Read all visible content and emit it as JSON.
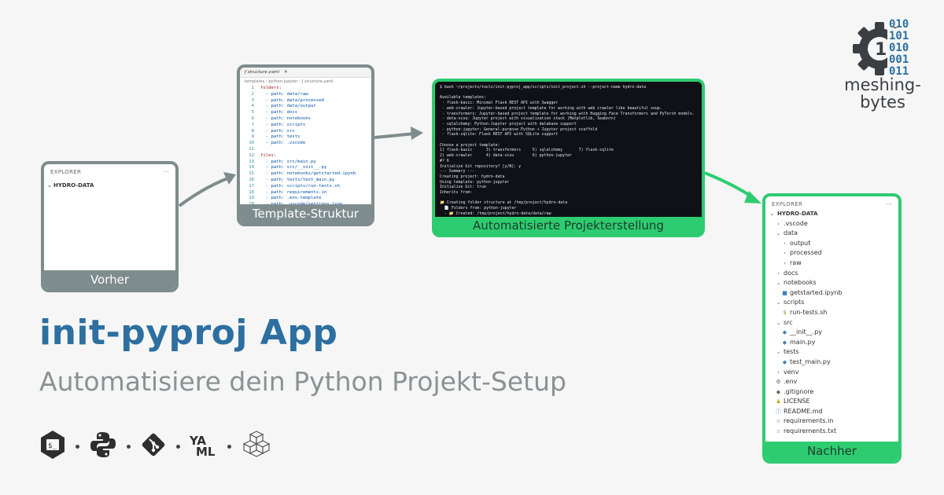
{
  "colors": {
    "gray": "#7f8c8d",
    "green": "#2ecc71",
    "title_blue": "#2c6fa0",
    "subtitle_gray": "#8a9394"
  },
  "vorher": {
    "explorer_label": "EXPLORER",
    "more": "···",
    "root": "HYDRO-DATA",
    "caption": "Vorher"
  },
  "template": {
    "tab_label": "structure.yaml",
    "breadcrumb": "templates › python-jupyter › ƒ structure.yaml",
    "caption": "Template-Struktur",
    "lines": [
      {
        "n": "1",
        "text": "folders:"
      },
      {
        "n": "2",
        "text": "  - path: data/raw"
      },
      {
        "n": "3",
        "text": "  - path: data/processed"
      },
      {
        "n": "4",
        "text": "  - path: data/output"
      },
      {
        "n": "5",
        "text": "  - path: docs"
      },
      {
        "n": "6",
        "text": "  - path: notebooks"
      },
      {
        "n": "7",
        "text": "  - path: scripts"
      },
      {
        "n": "8",
        "text": "  - path: src"
      },
      {
        "n": "9",
        "text": "  - path: tests"
      },
      {
        "n": "10",
        "text": "  - path: .vscode"
      },
      {
        "n": "11",
        "text": ""
      },
      {
        "n": "12",
        "text": "files:"
      },
      {
        "n": "13",
        "text": "  - path: src/main.py"
      },
      {
        "n": "14",
        "text": "  - path: src/__init__.py"
      },
      {
        "n": "15",
        "text": "  - path: notebooks/getstarted.ipynb"
      },
      {
        "n": "16",
        "text": "  - path: tests/test_main.py"
      },
      {
        "n": "17",
        "text": "  - path: scripts/run-tests.sh"
      },
      {
        "n": "18",
        "text": "  - path: requirements.in"
      },
      {
        "n": "19",
        "text": "  - path: .env.template"
      },
      {
        "n": "20",
        "text": "  - path: .vscode/settings.json"
      },
      {
        "n": "21",
        "text": ""
      }
    ]
  },
  "terminal": {
    "caption": "Automatisierte Projekterstellung",
    "text": "$ bash ~/projects/tools/init-pyproj_app/scripts/init_project.sh --project-name hydro-data\n\nAvailable templates:\n - flask-basic: Minimal Flask REST API with Swagger\n - web-crawler: Jupyter-based project template for working with web crawler like beautiful soup.\n - transformers: Jupyter-based project template for working with Hugging Face Transformers and PyTorch models.\n - data-visu: Jupyter project with visualization stack (Matplotlib, Seaborn)\n - sqlalchemy: Python-Jupyter project with database support\n - python-jupyter: General-purpose Python + Jupyter project scaffold\n - flask-sqlite: Flask REST API with SQLite support\n\nChoose a project template:\n1) flask-basic      3) transformers     5) sqlalchemy       7) flask-sqlite\n2) web-crawler      4) data-visu        6) python-jupyter\n#? 6\nInitialize Git repository? [y/N]: y\n--- Summary ---\nCreating project: hydro-data\nUsing template: python-jupyter\nInitialize Git: true\nInherits from:\n\n📁 Creating folder structure at /tmp/project/hydro-data\n  📄 Folders from: python-jupyter\n  - 📁 Created: /tmp/project/hydro-data/data/raw\n  - 📁 Created: /tmp/project/hydro-data/data/processed\n  - 📁 Created: /tmp/project/hydro-data/data/output"
  },
  "nachher": {
    "explorer_label": "EXPLORER",
    "more": "···",
    "caption": "Nachher",
    "tree": [
      {
        "icon": "chev-down",
        "glyph": "⌄",
        "label": "HYDRO-DATA",
        "indent": 0,
        "bold": true
      },
      {
        "icon": "chev-right",
        "glyph": "›",
        "label": ".vscode",
        "indent": 1
      },
      {
        "icon": "chev-down",
        "glyph": "⌄",
        "label": "data",
        "indent": 1
      },
      {
        "icon": "chev-right",
        "glyph": "›",
        "label": "output",
        "indent": 2
      },
      {
        "icon": "chev-right",
        "glyph": "›",
        "label": "processed",
        "indent": 2
      },
      {
        "icon": "chev-right",
        "glyph": "›",
        "label": "raw",
        "indent": 2
      },
      {
        "icon": "chev-right",
        "glyph": "›",
        "label": "docs",
        "indent": 1
      },
      {
        "icon": "chev-down",
        "glyph": "⌄",
        "label": "notebooks",
        "indent": 1
      },
      {
        "icon": "notebook",
        "glyph": "■",
        "label": "getstarted.ipynb",
        "indent": 2
      },
      {
        "icon": "chev-down",
        "glyph": "⌄",
        "label": "scripts",
        "indent": 1
      },
      {
        "icon": "shell",
        "glyph": "$",
        "label": "run-tests.sh",
        "indent": 2
      },
      {
        "icon": "chev-down",
        "glyph": "⌄",
        "label": "src",
        "indent": 1
      },
      {
        "icon": "python",
        "glyph": "◆",
        "label": "__init__.py",
        "indent": 2
      },
      {
        "icon": "python",
        "glyph": "◆",
        "label": "main.py",
        "indent": 2
      },
      {
        "icon": "chev-down",
        "glyph": "⌄",
        "label": "tests",
        "indent": 1
      },
      {
        "icon": "python",
        "glyph": "◆",
        "label": "test_main.py",
        "indent": 2
      },
      {
        "icon": "chev-right",
        "glyph": "›",
        "label": "venv",
        "indent": 1
      },
      {
        "icon": "gear",
        "glyph": "⚙",
        "label": ".env",
        "indent": 1
      },
      {
        "icon": "git",
        "glyph": "◆",
        "label": ".gitignore",
        "indent": 1
      },
      {
        "icon": "license",
        "glyph": "♟",
        "label": "LICENSE",
        "indent": 1
      },
      {
        "icon": "info",
        "glyph": "ⓘ",
        "label": "README.md",
        "indent": 1
      },
      {
        "icon": "text",
        "glyph": "≡",
        "label": "requirements.in",
        "indent": 1
      },
      {
        "icon": "text",
        "glyph": "≡",
        "label": "requirements.txt",
        "indent": 1
      }
    ]
  },
  "heading": {
    "title": "init-pyproj App",
    "subtitle": "Automatisiere dein Python Projekt-Setup"
  },
  "tech_icons": [
    "bash-icon",
    "python-icon",
    "git-icon",
    "yaml-icon",
    "boxes-icon"
  ],
  "yaml_icon_text": [
    "YA",
    "ML"
  ],
  "logo": {
    "binary": [
      "010",
      "101",
      "010",
      "001",
      "011"
    ],
    "name_line1": "meshing-",
    "name_line2": "bytes"
  }
}
